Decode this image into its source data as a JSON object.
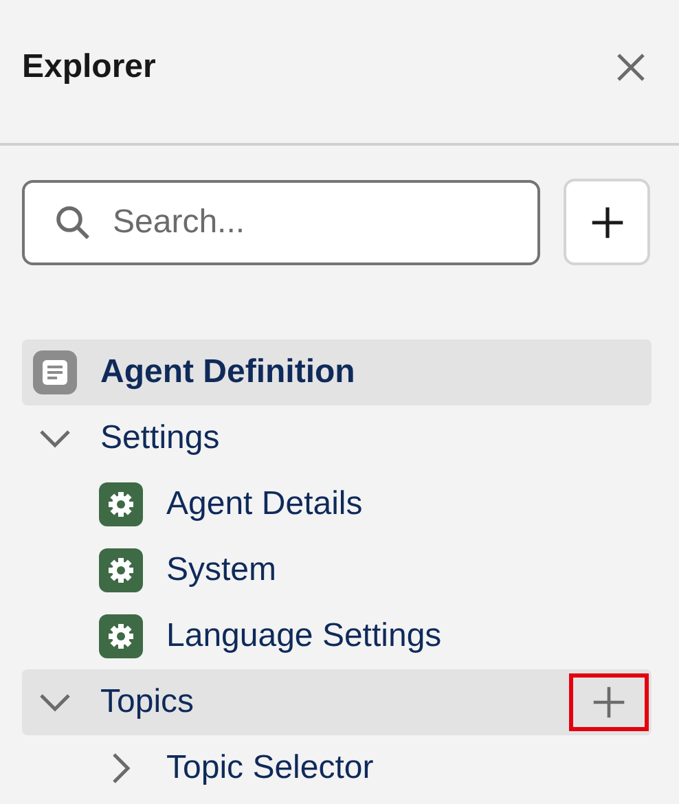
{
  "panel": {
    "title": "Explorer"
  },
  "search": {
    "placeholder": "Search..."
  },
  "tree": [
    {
      "label": "Agent Definition",
      "kind": "root",
      "highlighted": true
    },
    {
      "label": "Settings",
      "kind": "group",
      "expanded": true,
      "highlighted": false,
      "children": [
        {
          "label": "Agent Details",
          "kind": "setting"
        },
        {
          "label": "System",
          "kind": "setting"
        },
        {
          "label": "Language Settings",
          "kind": "setting"
        }
      ]
    },
    {
      "label": "Topics",
      "kind": "group",
      "expanded": true,
      "highlighted": true,
      "add_button": {
        "outlined": true
      },
      "children": [
        {
          "label": "Topic Selector",
          "kind": "group",
          "expanded": false,
          "highlighted": false
        }
      ]
    }
  ]
}
